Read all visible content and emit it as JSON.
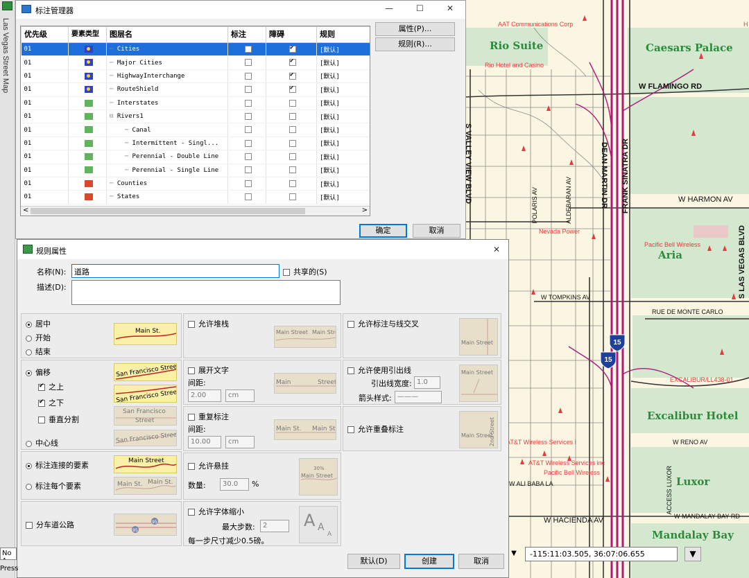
{
  "side_tab": {
    "label": "Las Vegas Street Map"
  },
  "manager": {
    "title": "标注管理器",
    "controls": {
      "minimize": "—",
      "maximize": "☐",
      "close": "✕"
    },
    "columns": [
      "优先级",
      "要素类型",
      "图层名",
      "标注",
      "障碍",
      "规则"
    ],
    "rows": [
      {
        "priority": "01",
        "type": "point",
        "name": "Cities",
        "indent": 0,
        "label": false,
        "barrier": true,
        "rule": "[默认]",
        "selected": true
      },
      {
        "priority": "01",
        "type": "point",
        "name": "Major Cities",
        "indent": 0,
        "label": false,
        "barrier": true,
        "rule": "[默认]"
      },
      {
        "priority": "01",
        "type": "point",
        "name": "HighwayInterchange",
        "indent": 0,
        "label": false,
        "barrier": true,
        "rule": "[默认]"
      },
      {
        "priority": "01",
        "type": "point",
        "name": "RouteShield",
        "indent": 0,
        "label": false,
        "barrier": true,
        "rule": "[默认]"
      },
      {
        "priority": "01",
        "type": "line",
        "name": "Interstates",
        "indent": 0,
        "label": false,
        "barrier": false,
        "rule": "[默认]"
      },
      {
        "priority": "01",
        "type": "line",
        "name": "Rivers1",
        "indent": 0,
        "expander": "⊟",
        "label": false,
        "barrier": false,
        "rule": "[默认]"
      },
      {
        "priority": "01",
        "type": "line",
        "name": "Canal",
        "indent": 1,
        "label": false,
        "barrier": false,
        "rule": "[默认]"
      },
      {
        "priority": "01",
        "type": "line",
        "name": "Intermittent - Singl...",
        "indent": 1,
        "label": false,
        "barrier": false,
        "rule": "[默认]"
      },
      {
        "priority": "01",
        "type": "line",
        "name": "Perennial - Double Line",
        "indent": 1,
        "label": false,
        "barrier": false,
        "rule": "[默认]"
      },
      {
        "priority": "01",
        "type": "line",
        "name": "Perennial - Single Line",
        "indent": 1,
        "label": false,
        "barrier": false,
        "rule": "[默认]"
      },
      {
        "priority": "01",
        "type": "region",
        "name": "Counties",
        "indent": 0,
        "label": false,
        "barrier": false,
        "rule": "[默认]"
      },
      {
        "priority": "01",
        "type": "region",
        "name": "States",
        "indent": 0,
        "label": false,
        "barrier": false,
        "rule": "[默认]"
      }
    ],
    "scroll_left": "<",
    "scroll_right": ">",
    "btn_properties": "属性(P)...",
    "btn_rules": "规则(R)...",
    "btn_ok": "确定",
    "btn_cancel": "取消"
  },
  "rule_dialog": {
    "title": "规则属性",
    "close": "✕",
    "name_label": "名称(N):",
    "name_value": "道路",
    "shared_label": "共享的(S)",
    "desc_label": "描述(D):",
    "desc_value": "",
    "position": {
      "center": "居中",
      "start": "开始",
      "end": "结束",
      "selected": "center",
      "preview": "Main St."
    },
    "offset": {
      "offset": "偏移",
      "above": "之上",
      "below": "之下",
      "vertical_split": "垂直分割",
      "centerline": "中心线",
      "selected": "offset",
      "above_on": true,
      "below_on": true,
      "split_on": false,
      "preview_above": "San Francisco Street",
      "preview_below": "San Francisco Street",
      "preview_split_1": "San Francisco",
      "preview_split_2": "Street",
      "preview_center": "San Francisco Street"
    },
    "connect": {
      "label_connected": "标注连接的要素",
      "label_each": "标注每个要素",
      "selected": "label_connected",
      "preview_connected": "Main Street",
      "preview_each_1": "Main St.",
      "preview_each_2": "Main St."
    },
    "divided": {
      "label": "分车道公路",
      "on": false,
      "shield_top": "95",
      "shield_bottom": "95"
    },
    "stack": {
      "label": "允许堆栈",
      "on": false,
      "preview_1": "Main Street",
      "preview_2": "Main Street"
    },
    "spread": {
      "label": "展开文字",
      "on": false,
      "spacing_label": "间距:",
      "spacing_value": "2.00",
      "unit": "cm",
      "preview_left": "Main",
      "preview_right": "Street"
    },
    "repeat": {
      "label": "重复标注",
      "on": false,
      "spacing_label": "间距:",
      "spacing_value": "10.00",
      "unit": "cm",
      "preview_left": "Main St.",
      "preview_right": "Main St."
    },
    "overhang": {
      "label": "允许悬挂",
      "on": false,
      "count_label": "数量:",
      "count_value": "30.0",
      "count_unit": "%",
      "preview_pct": "30%",
      "preview": "Main Street"
    },
    "shrink": {
      "label": "允许字体缩小",
      "on": false,
      "max_steps_label": "最大步数:",
      "max_steps_value": "2",
      "step_text": "每一步尺寸减少0.5磅。",
      "glyph_big": "A",
      "glyph_mid": "A",
      "glyph_small": "A"
    },
    "cross": {
      "label": "允许标注与线交叉",
      "on": false,
      "preview": "Main Street"
    },
    "leader": {
      "label": "允许使用引出线",
      "on": false,
      "width_label": "引出线宽度:",
      "width_value": "1.0",
      "arrow_label": "箭头样式:",
      "arrow_value": "———",
      "preview": "Main Street"
    },
    "overlap": {
      "label": "允许重叠标注",
      "on": false,
      "preview": "Main Street",
      "preview_v": "2nd Street"
    },
    "btn_default": "默认(D)",
    "btn_create": "创建",
    "btn_cancel": "取消"
  },
  "map": {
    "places": [
      "Rio Suite",
      "Caesars Palace",
      "Aria",
      "Excalibur Hotel",
      "Luxor",
      "Mandalay Bay"
    ],
    "poi_labels": [
      "AAT Communications Corp",
      "Rio Hotel and Casino",
      "Nevada Power",
      "Pacific Bell Wireless",
      "EXCALIBUR/LL438-01",
      "AT&T Wireless Services i",
      "AT&T Wireless Services inc",
      "Pacific Bell Wireless",
      "H"
    ],
    "streets": {
      "flamingo": "W FLAMINGO RD",
      "harmon": "W HARMON AV",
      "tompkins": "W TOMPKINS AV",
      "monte_carlo": "RUE DE MONTE CARLO",
      "reno": "W RENO AV",
      "ali_baba": "W ALI BABA LA",
      "hacienda": "W HACIENDA AV",
      "mandalay_bay_rd": "W MANDALAY BAY RD",
      "valley_view": "S VALLEY VIEW BLVD",
      "dean_martin": "DEAN MARTIN DR",
      "sinatra": "FRANK SINATRA DR",
      "polaris": "POLARIS AV",
      "aldebaran": "ALDEBARAN AV",
      "las_vegas_blvd": "S LAS VEGAS BLVD",
      "access_luxor": "ACCESS LUXOR"
    },
    "shields": [
      "15",
      "15"
    ]
  },
  "statusbar": {
    "left_field": "No A",
    "press": "Press",
    "left_dropdown": "▼",
    "coordinates": "-115:11:03.505, 36:07:06.655",
    "coord_dropdown": "▼"
  },
  "colors": {
    "selection": "#1e6fd9",
    "map_bg": "#fbf6e2",
    "green_area": "#d4e8cf",
    "highway": "#b0187a",
    "poi": "#e53b3b",
    "place_text": "#2d8a3a"
  }
}
